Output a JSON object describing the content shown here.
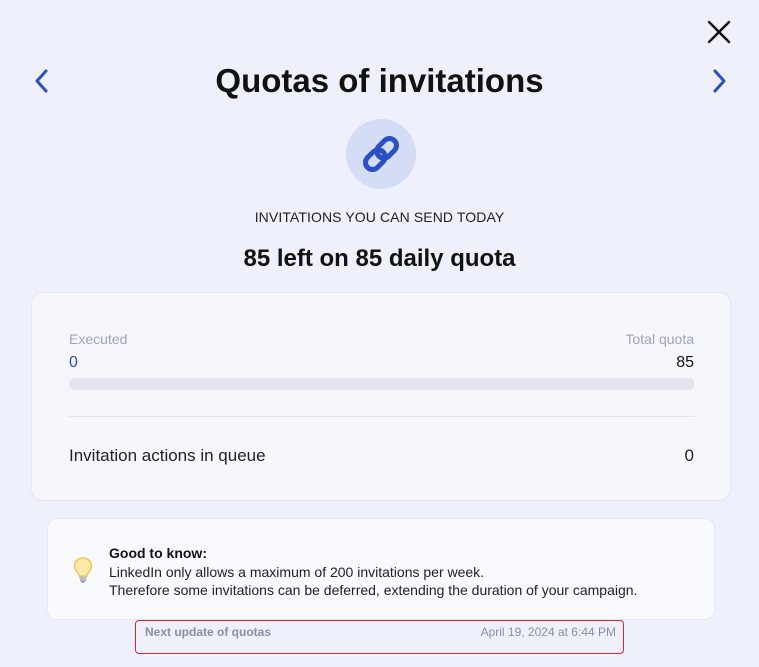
{
  "header": {
    "title": "Quotas of invitations",
    "close_icon": "close-icon",
    "prev_icon": "chevron-left-icon",
    "next_icon": "chevron-right-icon"
  },
  "summary": {
    "icon": "link-icon",
    "subtitle": "INVITATIONS YOU CAN SEND TODAY",
    "headline": "85 left on 85 daily quota"
  },
  "quota": {
    "executed_label": "Executed",
    "executed_value": "0",
    "total_label": "Total quota",
    "total_value": "85",
    "progress_fraction": 0,
    "queue_label": "Invitation actions in queue",
    "queue_value": "0"
  },
  "tip": {
    "icon": "lightbulb-icon",
    "title": "Good to know:",
    "line1": "LinkedIn only allows a maximum of 200 invitations per week.",
    "line2": "Therefore some invitations can be deferred, extending the duration of your campaign."
  },
  "update": {
    "label": "Next update of quotas",
    "date": "April 19, 2024 at 6:44 PM"
  },
  "colors": {
    "accent": "#2a4fc6",
    "background": "#eef0fb",
    "highlight_border": "#e0242d"
  }
}
